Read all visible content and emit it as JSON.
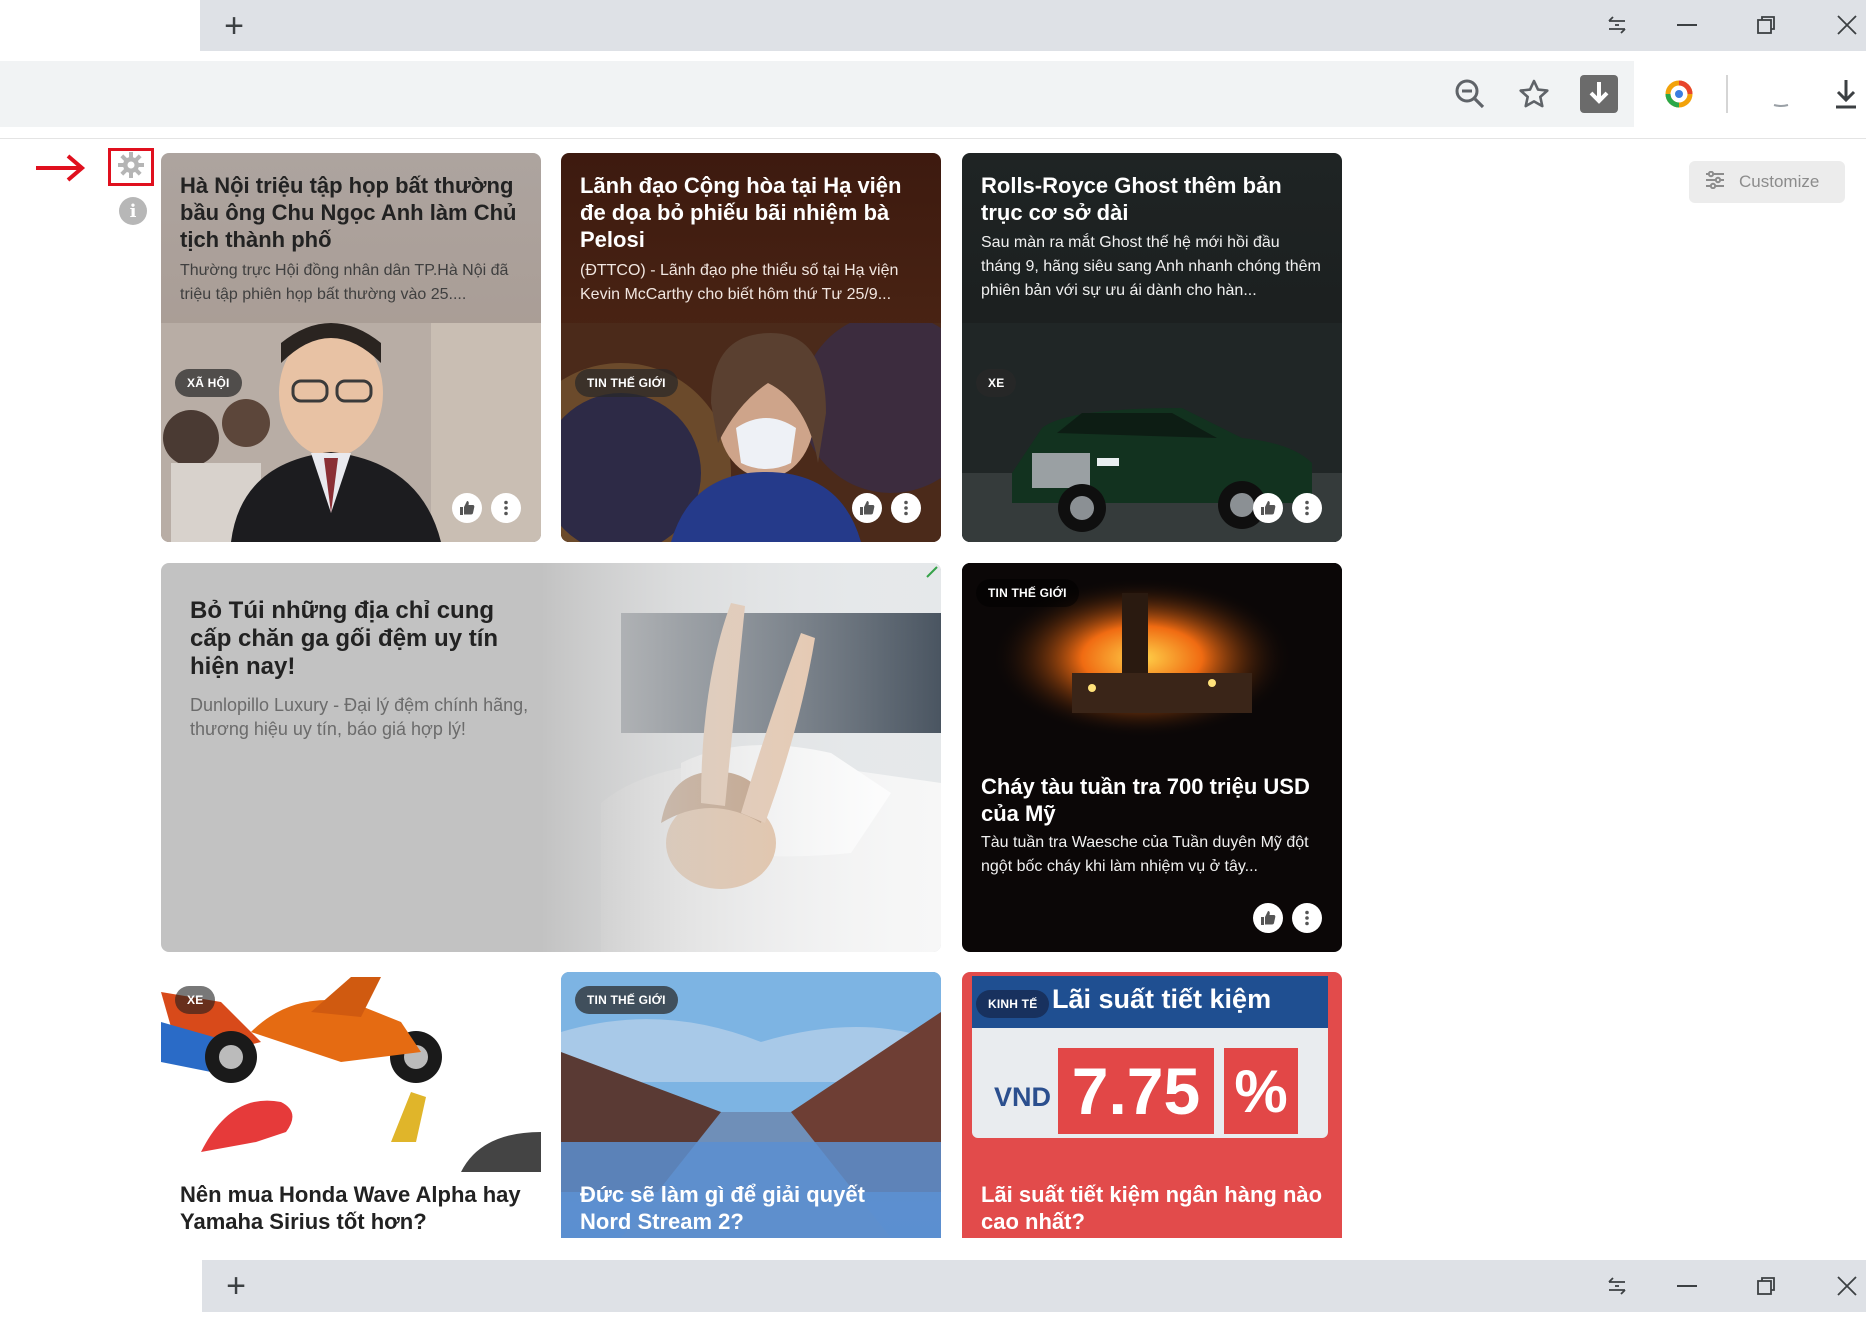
{
  "browser": {
    "new_tab_label": "+",
    "window_controls": [
      "minimize",
      "restore",
      "close"
    ]
  },
  "toolbar": {
    "icons": [
      "zoom-out-icon",
      "star-icon",
      "download-extension-icon",
      "extension-ring-icon",
      "download-icon"
    ]
  },
  "sidebar": {
    "settings_icon": "gear-icon",
    "info_icon": "info-icon",
    "info_glyph": "i"
  },
  "customize": {
    "label": "Customize"
  },
  "cards": [
    {
      "title": "Hà Nội triệu tập họp bất thường bầu ông Chu Ngọc Anh làm Chủ tịch thành phố",
      "description": "Thường trực Hội đồng nhân dân TP.Hà Nội đã triệu tập phiên họp bất thường vào 25....",
      "badge": "XÃ HỘI"
    },
    {
      "title": "Lãnh đạo Cộng hòa tại Hạ viện đe dọa bỏ phiếu bãi nhiệm bà Pelosi",
      "description": "(ĐTTCO) - Lãnh đạo phe thiểu số tại Hạ viện Kevin McCarthy cho biết hôm thứ Tư 25/9...",
      "badge": "TIN THẾ GIỚI"
    },
    {
      "title": "Rolls-Royce Ghost thêm bản trục cơ sở dài",
      "description": "Sau màn ra mắt Ghost thế hệ mới hồi đầu tháng 9, hãng siêu sang Anh nhanh chóng thêm phiên bản với sự ưu ái dành cho hàn...",
      "badge": "XE"
    },
    {
      "title": "Bỏ Túi những địa chỉ cung cấp chăn ga gối đệm uy tín hiện nay!",
      "description": "Dunlopillo Luxury - Đại lý đệm chính hãng, thương hiệu uy tín, báo giá hợp lý!"
    },
    {
      "title": "Cháy tàu tuần tra 700 triệu USD của Mỹ",
      "description": "Tàu tuần tra Waesche của Tuần duyên Mỹ đột ngột bốc cháy khi làm nhiệm vụ ở tây...",
      "badge": "TIN THẾ GIỚI"
    },
    {
      "title": "Nên mua Honda Wave Alpha hay Yamaha Sirius tốt hơn?",
      "badge": "XE"
    },
    {
      "title": "Đức sẽ làm gì để giải quyết Nord Stream 2?",
      "badge": "TIN THẾ GIỚI"
    },
    {
      "title": "Lãi suất tiết kiệm ngân hàng nào cao nhất?",
      "badge": "KINH TẾ",
      "image_headline": "Lãi suất tiết kiệm",
      "image_currency": "VND",
      "image_rate": "7.75",
      "image_percent": "%"
    }
  ]
}
